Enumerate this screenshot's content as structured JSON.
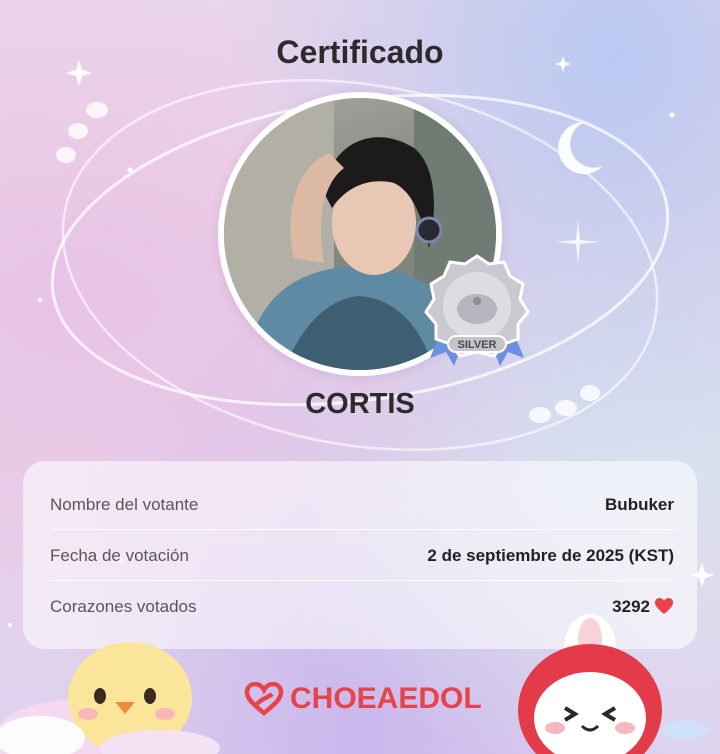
{
  "header": {
    "title": "Certificado"
  },
  "idol": {
    "name": "CORTIS",
    "photo_icon": "idol-photo",
    "badge_label": "SILVER"
  },
  "details": [
    {
      "label": "Nombre del votante",
      "value": "Bubuker"
    },
    {
      "label": "Fecha de votación",
      "value": "2 de septiembre de 2025 (KST)"
    },
    {
      "label": "Corazones votados",
      "value": "3292"
    }
  ],
  "brand": {
    "name": "CHOEAEDOL",
    "color": "#e8424a"
  },
  "colors": {
    "heart": "#e8424a",
    "silver": "#c9c9cf",
    "ribbon": "#6c8fe0"
  }
}
